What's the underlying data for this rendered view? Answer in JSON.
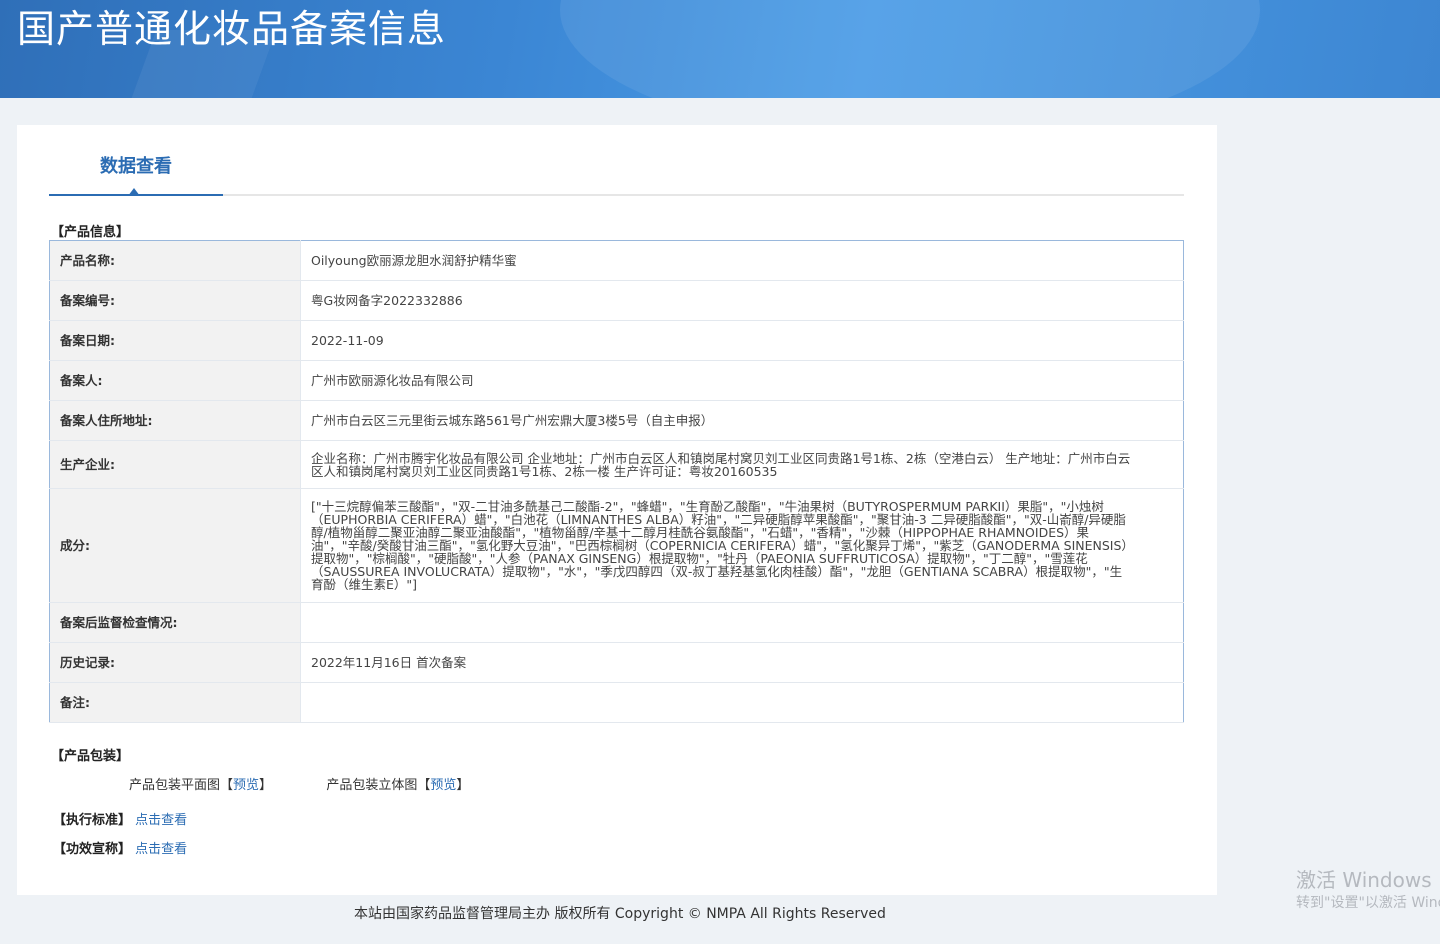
{
  "header": {
    "title": "国产普通化妆品备案信息"
  },
  "tab": {
    "label": "数据查看"
  },
  "product_info": {
    "section_title": "【产品信息】",
    "rows": [
      {
        "label": "产品名称:",
        "value": "Oilyoung欧丽源龙胆水润舒护精华蜜"
      },
      {
        "label": "备案编号:",
        "value": "粤G妆网备字2022332886"
      },
      {
        "label": "备案日期:",
        "value": "2022-11-09"
      },
      {
        "label": "备案人:",
        "value": "广州市欧丽源化妆品有限公司"
      },
      {
        "label": "备案人住所地址:",
        "value": "广州市白云区三元里街云城东路561号广州宏鼎大厦3楼5号（自主申报）"
      },
      {
        "label": "生产企业:",
        "value": "企业名称：广州市腾宇化妆品有限公司 企业地址：广州市白云区人和镇岗尾村窝贝刘工业区同贵路1号1栋、2栋（空港白云） 生产地址：广州市白云区人和镇岗尾村窝贝刘工业区同贵路1号1栋、2栋一楼 生产许可证：粤妆20160535"
      },
      {
        "label": "成分:",
        "value": "[\"十三烷醇偏苯三酸酯\"，\"双-二甘油多酰基己二酸酯-2\"，\"蜂蜡\"，\"生育酚乙酸酯\"，\"牛油果树（BUTYROSPERMUM PARKII）果脂\"，\"小烛树（EUPHORBIA CERIFERA）蜡\"，\"白池花（LIMNANTHES ALBA）籽油\"，\"二异硬脂醇苹果酸酯\"，\"聚甘油-3 二异硬脂酸酯\"，\"双-山嵛醇/异硬脂醇/植物甾醇二聚亚油醇二聚亚油酸酯\"，\"植物甾醇/辛基十二醇月桂酰谷氨酸酯\"，\"石蜡\"，\"香精\"，\"沙棘（HIPPOPHAE RHAMNOIDES）果油\"，\"辛酸/癸酸甘油三酯\"，\"氢化野大豆油\"，\"巴西棕榈树（COPERNICIA CERIFERA）蜡\"，\"氢化聚异丁烯\"，\"紫芝（GANODERMA SINENSIS）提取物\"，\"棕榈酸\"，\"硬脂酸\"，\"人参（PANAX GINSENG）根提取物\"，\"牡丹（PAEONIA SUFFRUTICOSA）提取物\"，\"丁二醇\"，\"雪莲花（SAUSSUREA INVOLUCRATA）提取物\"，\"水\"，\"季戊四醇四（双-叔丁基羟基氢化肉桂酸）酯\"，\"龙胆（GENTIANA SCABRA）根提取物\"，\"生育酚（维生素E）\"]"
      },
      {
        "label": "备案后监督检查情况:",
        "value": ""
      },
      {
        "label": "历史记录:",
        "value": "2022年11月16日 首次备案"
      },
      {
        "label": "备注:",
        "value": ""
      }
    ]
  },
  "packaging": {
    "section_title": "【产品包装】",
    "flat_label": "产品包装平面图",
    "solid_label": "产品包装立体图",
    "bracket_open": "【",
    "bracket_close": "】",
    "preview_label": "预览"
  },
  "standard": {
    "label": "【执行标准】",
    "link": "点击查看"
  },
  "efficacy": {
    "label": "【功效宣称】",
    "link": "点击查看"
  },
  "footer": {
    "text": "本站由国家药品监督管理局主办 版权所有 Copyright © NMPA All Rights Reserved"
  },
  "watermark": {
    "line1": "激活 Windows",
    "line2": "转到\"设置\"以激活 Windows。"
  }
}
